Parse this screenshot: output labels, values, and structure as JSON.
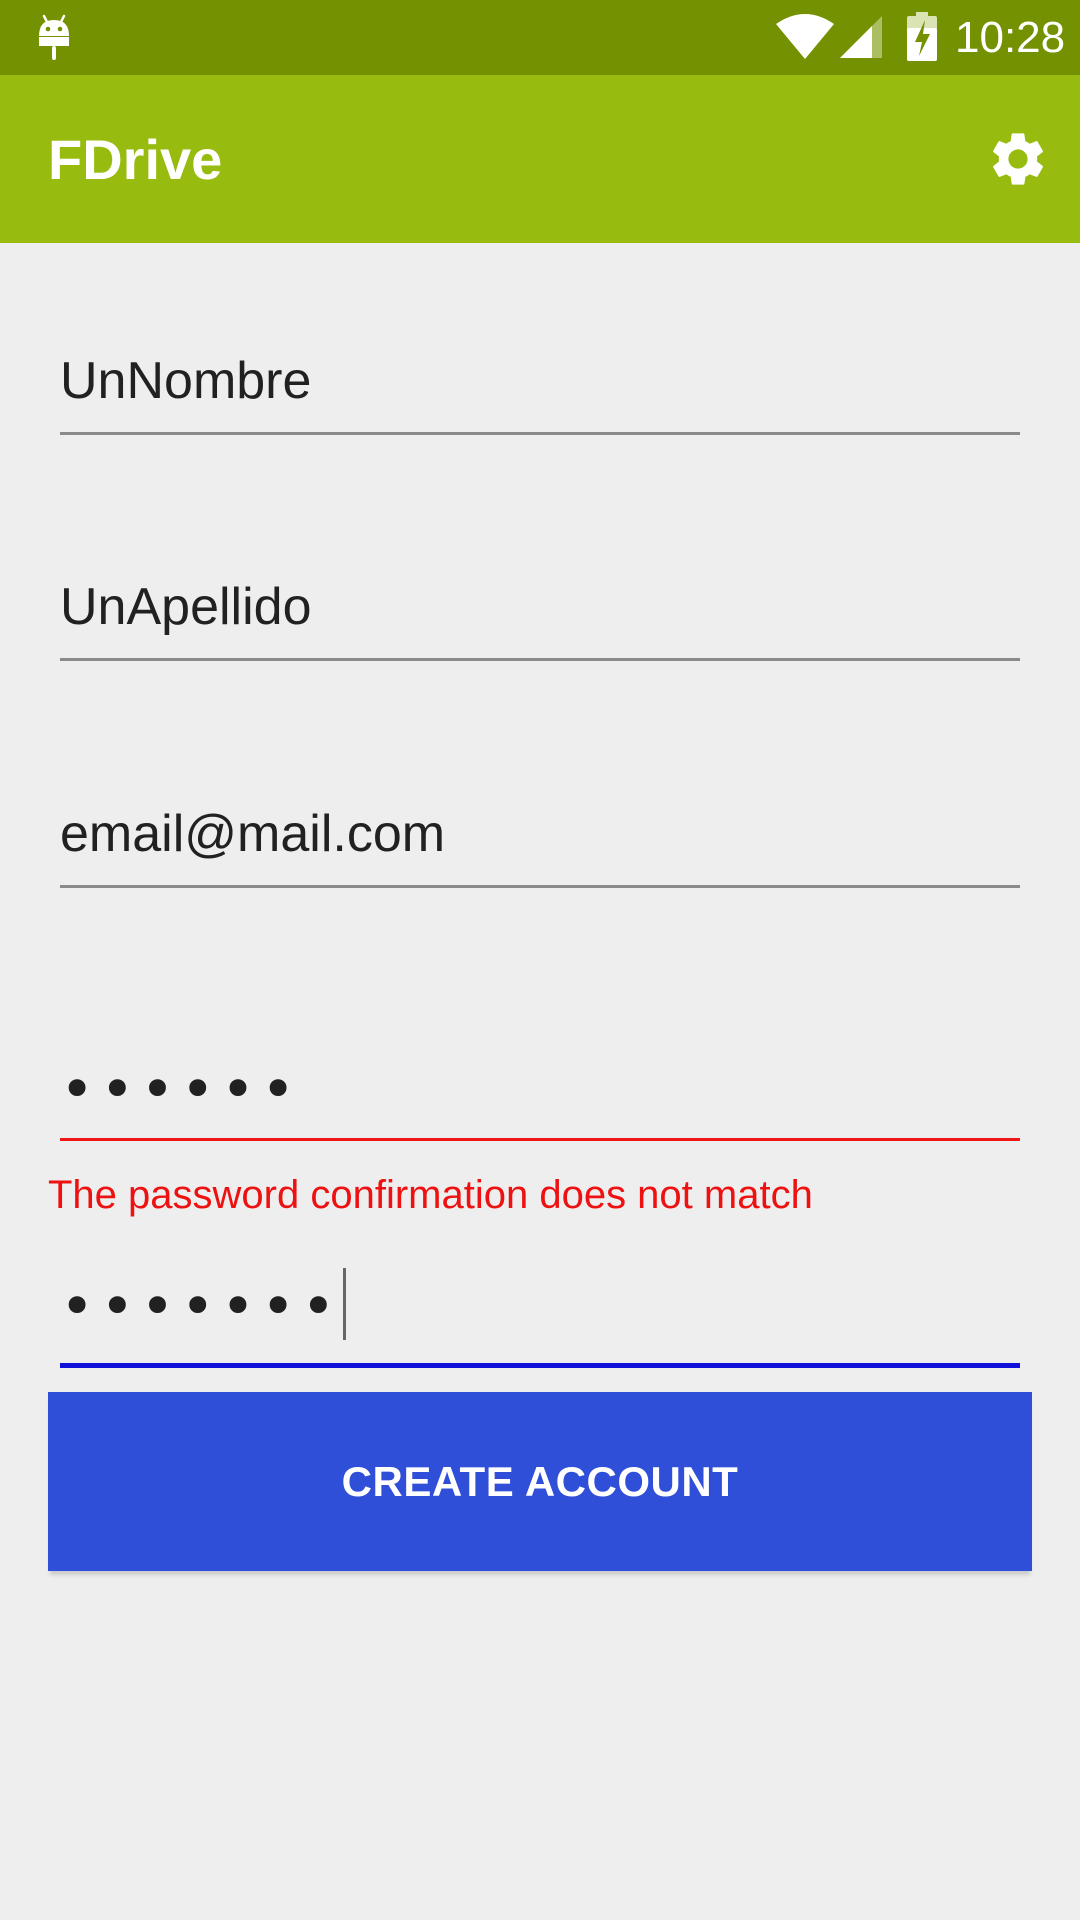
{
  "status_bar": {
    "time": "10:28",
    "icons": [
      "android-icon",
      "wifi-icon",
      "signal-icon",
      "battery-charging-icon"
    ]
  },
  "app_bar": {
    "title": "FDrive",
    "settings_icon": "gear-icon"
  },
  "form": {
    "first_name": {
      "value": "UnNombre"
    },
    "last_name": {
      "value": "UnApellido"
    },
    "email": {
      "value": "email@mail.com"
    },
    "password": {
      "value": "••••••"
    },
    "confirm_password": {
      "value": "•••••••",
      "focused": true
    },
    "error_message": "The password confirmation does not match",
    "submit_label": "CREATE ACCOUNT"
  },
  "colors": {
    "status_bar": "#739100",
    "app_bar": "#97bc0f",
    "error": "#f01616",
    "focus": "#1010d8",
    "button": "#2f4fd9"
  }
}
